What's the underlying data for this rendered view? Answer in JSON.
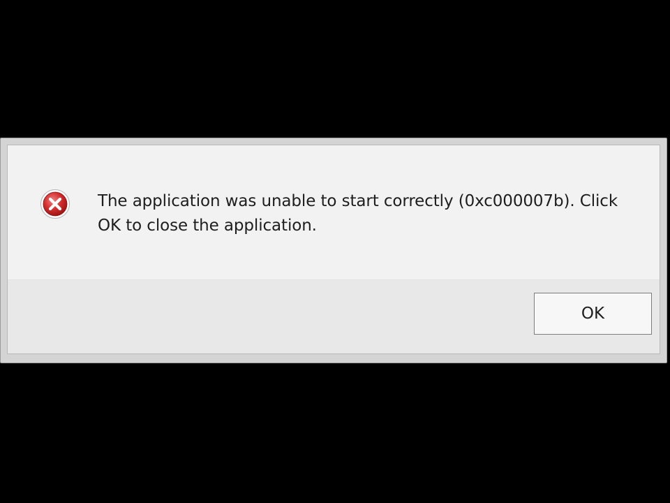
{
  "dialog": {
    "icon": "error-icon",
    "icon_color": "#d32f2f",
    "message": "The application was unable to start correctly (0xc000007b). Click OK to close the application.",
    "ok_label": "OK"
  }
}
